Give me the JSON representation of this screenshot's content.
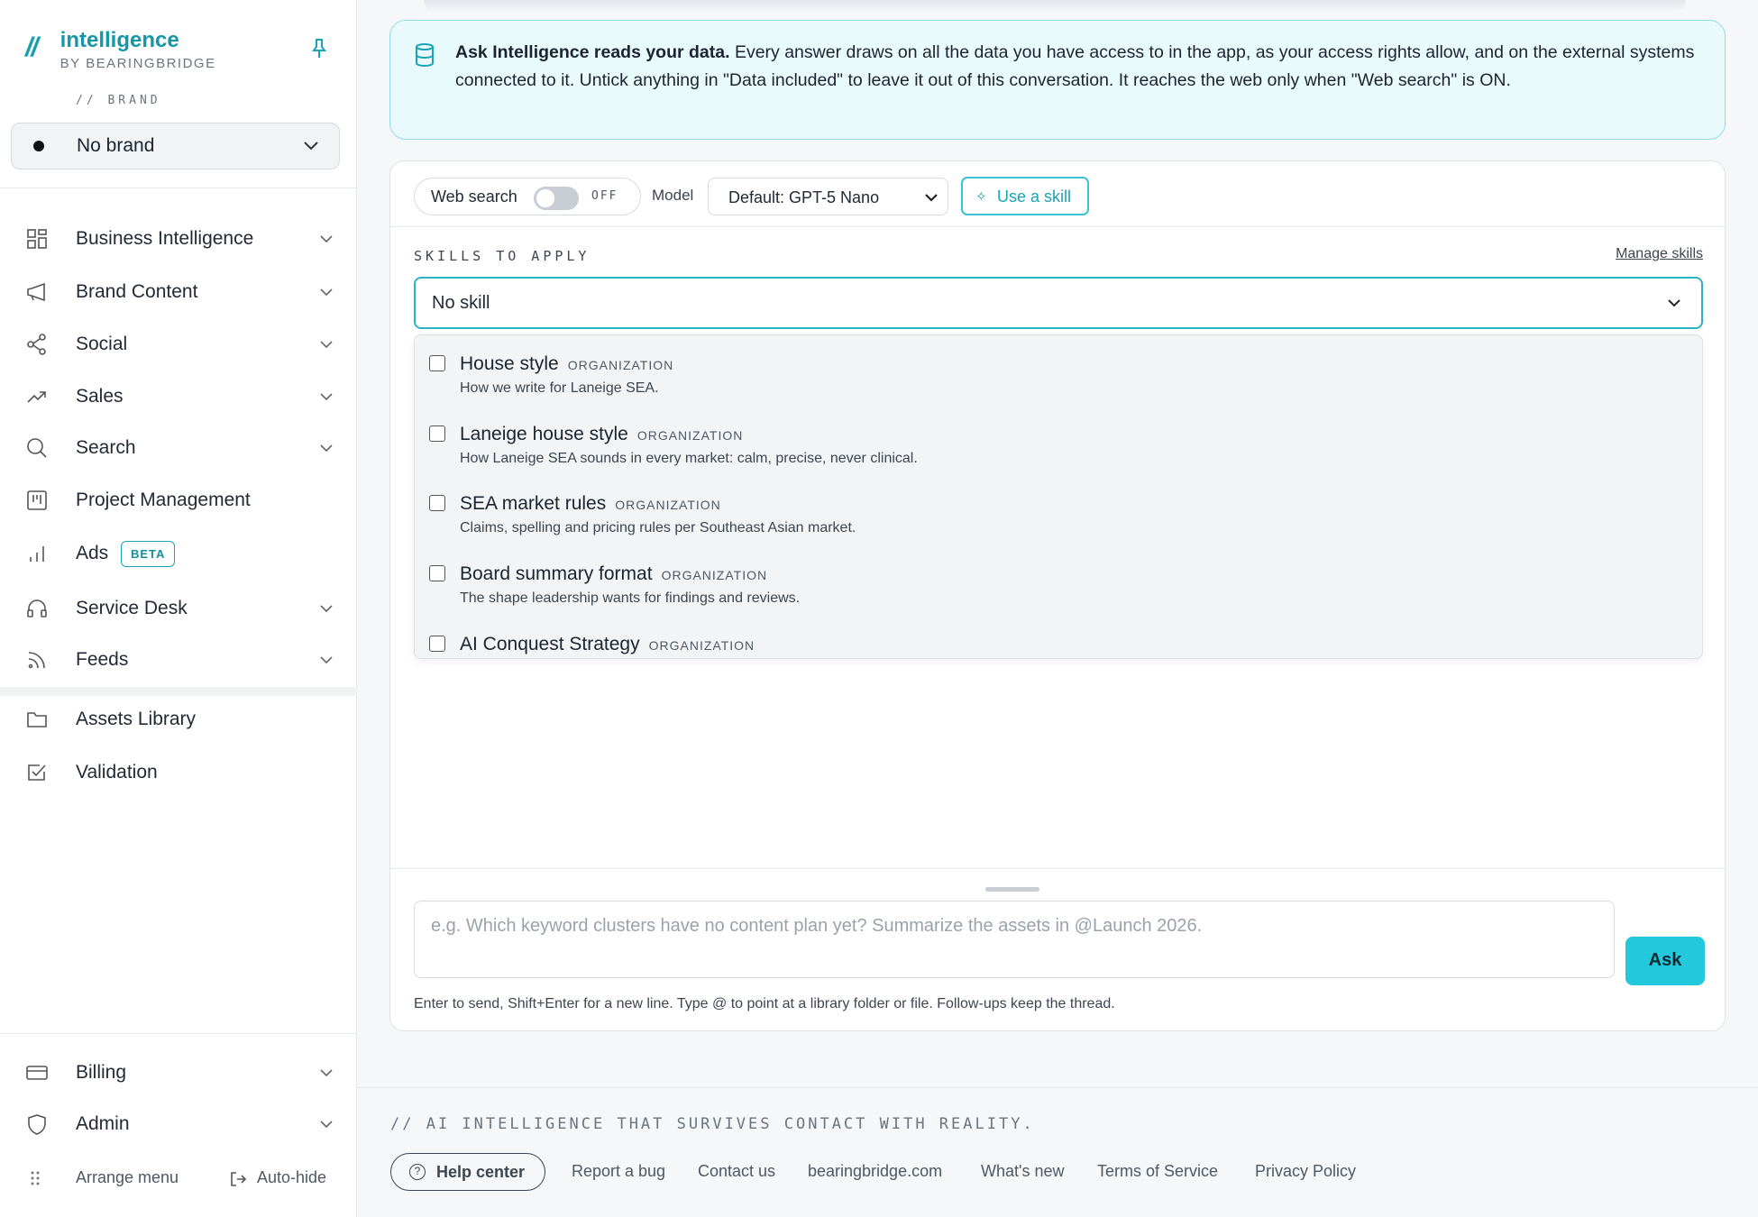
{
  "brand_logo": {
    "mark": "//",
    "title": "intelligence",
    "subtitle": "BY BEARINGBRIDGE"
  },
  "brand_section": {
    "caption": "// BRAND",
    "selected": "No brand"
  },
  "nav": {
    "items": [
      {
        "label": "Business Intelligence",
        "icon": "grid-icon",
        "has_chevron": true
      },
      {
        "label": "Brand Content",
        "icon": "megaphone-icon",
        "has_chevron": true
      },
      {
        "label": "Social",
        "icon": "share-icon",
        "has_chevron": true
      },
      {
        "label": "Sales",
        "icon": "trending-up-icon",
        "has_chevron": true
      },
      {
        "label": "Search",
        "icon": "search-icon",
        "has_chevron": true
      },
      {
        "label": "Project Management",
        "icon": "kanban-icon",
        "has_chevron": false
      },
      {
        "label": "Ads",
        "icon": "bar-chart-icon",
        "has_chevron": false,
        "badge": "BETA"
      },
      {
        "label": "Service Desk",
        "icon": "headset-icon",
        "has_chevron": true
      },
      {
        "label": "Feeds",
        "icon": "rss-icon",
        "has_chevron": true
      },
      {
        "label": "Assets Library",
        "icon": "folder-icon",
        "has_chevron": false
      },
      {
        "label": "Validation",
        "icon": "checkbox-icon",
        "has_chevron": false
      }
    ],
    "bottom": [
      {
        "label": "Billing",
        "icon": "credit-card-icon"
      },
      {
        "label": "Admin",
        "icon": "shield-icon"
      }
    ],
    "arrange_label": "Arrange menu",
    "autohide_label": "Auto-hide"
  },
  "info": {
    "bold": "Ask Intelligence reads your data.",
    "text": " Every answer draws on all the data you have access to in the app, as your access rights allow, and on the external systems connected to it. Untick anything in \"Data included\" to leave it out of this conversation. It reaches the web only when \"Web search\" is ON."
  },
  "toolbar": {
    "web_search_label": "Web search",
    "web_search_state": "OFF",
    "model_label": "Model",
    "model_value": "Default: GPT-5 Nano",
    "use_skill_label": "Use a skill"
  },
  "skills": {
    "caption": "SKILLS TO APPLY",
    "manage_label": "Manage skills",
    "selected": "No skill",
    "options": [
      {
        "title": "House style",
        "scope": "ORGANIZATION",
        "desc": "How we write for Laneige SEA."
      },
      {
        "title": "Laneige house style",
        "scope": "ORGANIZATION",
        "desc": "How Laneige SEA sounds in every market: calm, precise, never clinical."
      },
      {
        "title": "SEA market rules",
        "scope": "ORGANIZATION",
        "desc": "Claims, spelling and pricing rules per Southeast Asian market."
      },
      {
        "title": "Board summary format",
        "scope": "ORGANIZATION",
        "desc": "The shape leadership wants for findings and reviews."
      },
      {
        "title": "AI Conquest Strategy",
        "scope": "ORGANIZATION",
        "desc": ""
      }
    ]
  },
  "composer": {
    "placeholder": "e.g. Which keyword clusters have no content plan yet? Summarize the assets in @Launch 2026.",
    "ask_label": "Ask",
    "hint": "Enter to send, Shift+Enter for a new line. Type @ to point at a library folder or file. Follow-ups keep the thread."
  },
  "footer": {
    "tagline": "// AI INTELLIGENCE THAT SURVIVES CONTACT WITH REALITY.",
    "help_label": "Help center",
    "links": [
      "Report a bug",
      "Contact us",
      "bearingbridge.com",
      "What's new",
      "Terms of Service",
      "Privacy Policy"
    ]
  },
  "colors": {
    "accent": "#1aa3b4",
    "ask_button": "#22c8dc",
    "info_bg": "#e9fafc"
  }
}
